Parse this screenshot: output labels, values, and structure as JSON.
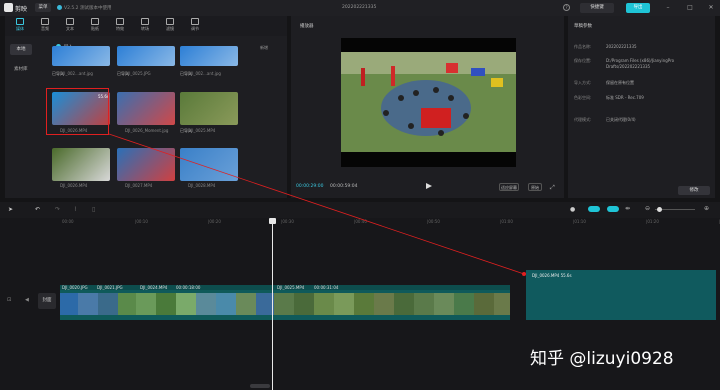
{
  "app": {
    "name": "剪映",
    "menu_label": "菜单",
    "version": "V2.5.2 测试版本中使用",
    "document_title": "202202221335",
    "shortcut_label": "快捷键",
    "export_label": "导出"
  },
  "tabs": [
    {
      "label": "媒体",
      "icon": "media-icon",
      "active": true
    },
    {
      "label": "音频",
      "icon": "audio-icon"
    },
    {
      "label": "文本",
      "icon": "text-icon"
    },
    {
      "label": "贴纸",
      "icon": "sticker-icon"
    },
    {
      "label": "特效",
      "icon": "effects-icon"
    },
    {
      "label": "转场",
      "icon": "transition-icon"
    },
    {
      "label": "滤镜",
      "icon": "filter-icon"
    },
    {
      "label": "调节",
      "icon": "adjust-icon"
    }
  ],
  "media": {
    "side_local": "本地",
    "side_library": "素材库",
    "import_label": "导入",
    "sort_label": "新增",
    "items": [
      {
        "label": "DJI_002...ant.jpg",
        "badge": "已导入",
        "colors": [
          "#2d7fd6",
          "#8ab8e6"
        ]
      },
      {
        "label": "DJI_0025.JPG",
        "badge": "已导入",
        "colors": [
          "#2d7fd6",
          "#8ab8e6"
        ]
      },
      {
        "label": "DJI_002...ant.jpg",
        "badge": "已导入",
        "colors": [
          "#2d7fd6",
          "#8ab8e6"
        ]
      },
      {
        "label": "DJI_0026.MP4",
        "badge": "",
        "duration": "55.6s",
        "colors": [
          "#1a8fd8",
          "#c04040"
        ]
      },
      {
        "label": "DJI_0026_Moment.jpg",
        "badge": "",
        "colors": [
          "#3a6fb0",
          "#d04848"
        ]
      },
      {
        "label": "DJI_0025.MP4",
        "badge": "已导入",
        "colors": [
          "#5a7a3a",
          "#8a9a5a"
        ]
      },
      {
        "label": "DJI_0026.MP4",
        "badge": "",
        "colors": [
          "#4a6a2a",
          "#d8d8d8"
        ]
      },
      {
        "label": "DJI_0027.MP4",
        "badge": "",
        "colors": [
          "#2a70b8",
          "#d04040"
        ]
      },
      {
        "label": "DJI_0028.MP4",
        "badge": "",
        "colors": [
          "#3a80c8",
          "#6aa0d8"
        ]
      }
    ]
  },
  "player": {
    "title": "播放器",
    "time_current": "00:00:29:00",
    "time_total": "00:00:59:04",
    "ratio_label": "适应屏幕",
    "original_label": "原始"
  },
  "properties": {
    "title": "草稿参数",
    "rows": [
      {
        "key": "作品名称:",
        "value": "202202221335"
      },
      {
        "key": "保存位置:",
        "value": "D:/Program Files (x86)/JianyingPro Drafts/202202221335"
      },
      {
        "key": "导入方式:",
        "value": "保留在原有位置"
      },
      {
        "key": "色彩空间:",
        "value": "标准 SDR - Rec.709"
      },
      {
        "key": "代理模式:",
        "value": "已关闭代理(0/4)"
      }
    ],
    "edit_label": "修改"
  },
  "timeline": {
    "ruler": [
      "00:00",
      "|00:10",
      "|00:20",
      "|00:30",
      "|00:40",
      "|00:50",
      "|01:00",
      "|01:10",
      "|01:20",
      "|01:30"
    ],
    "track_names": [
      "DJI_0020.JPG",
      "DJI_0021.JPG",
      "DJI_0024.MP4",
      "00:00:18:00",
      "DJI_0025.MP4",
      "00:00:31:04"
    ],
    "cover_label": "封面",
    "drop_clip_label": "DJI_0026.MP4  55.6s"
  },
  "watermark": "知乎 @lizuyi0928"
}
